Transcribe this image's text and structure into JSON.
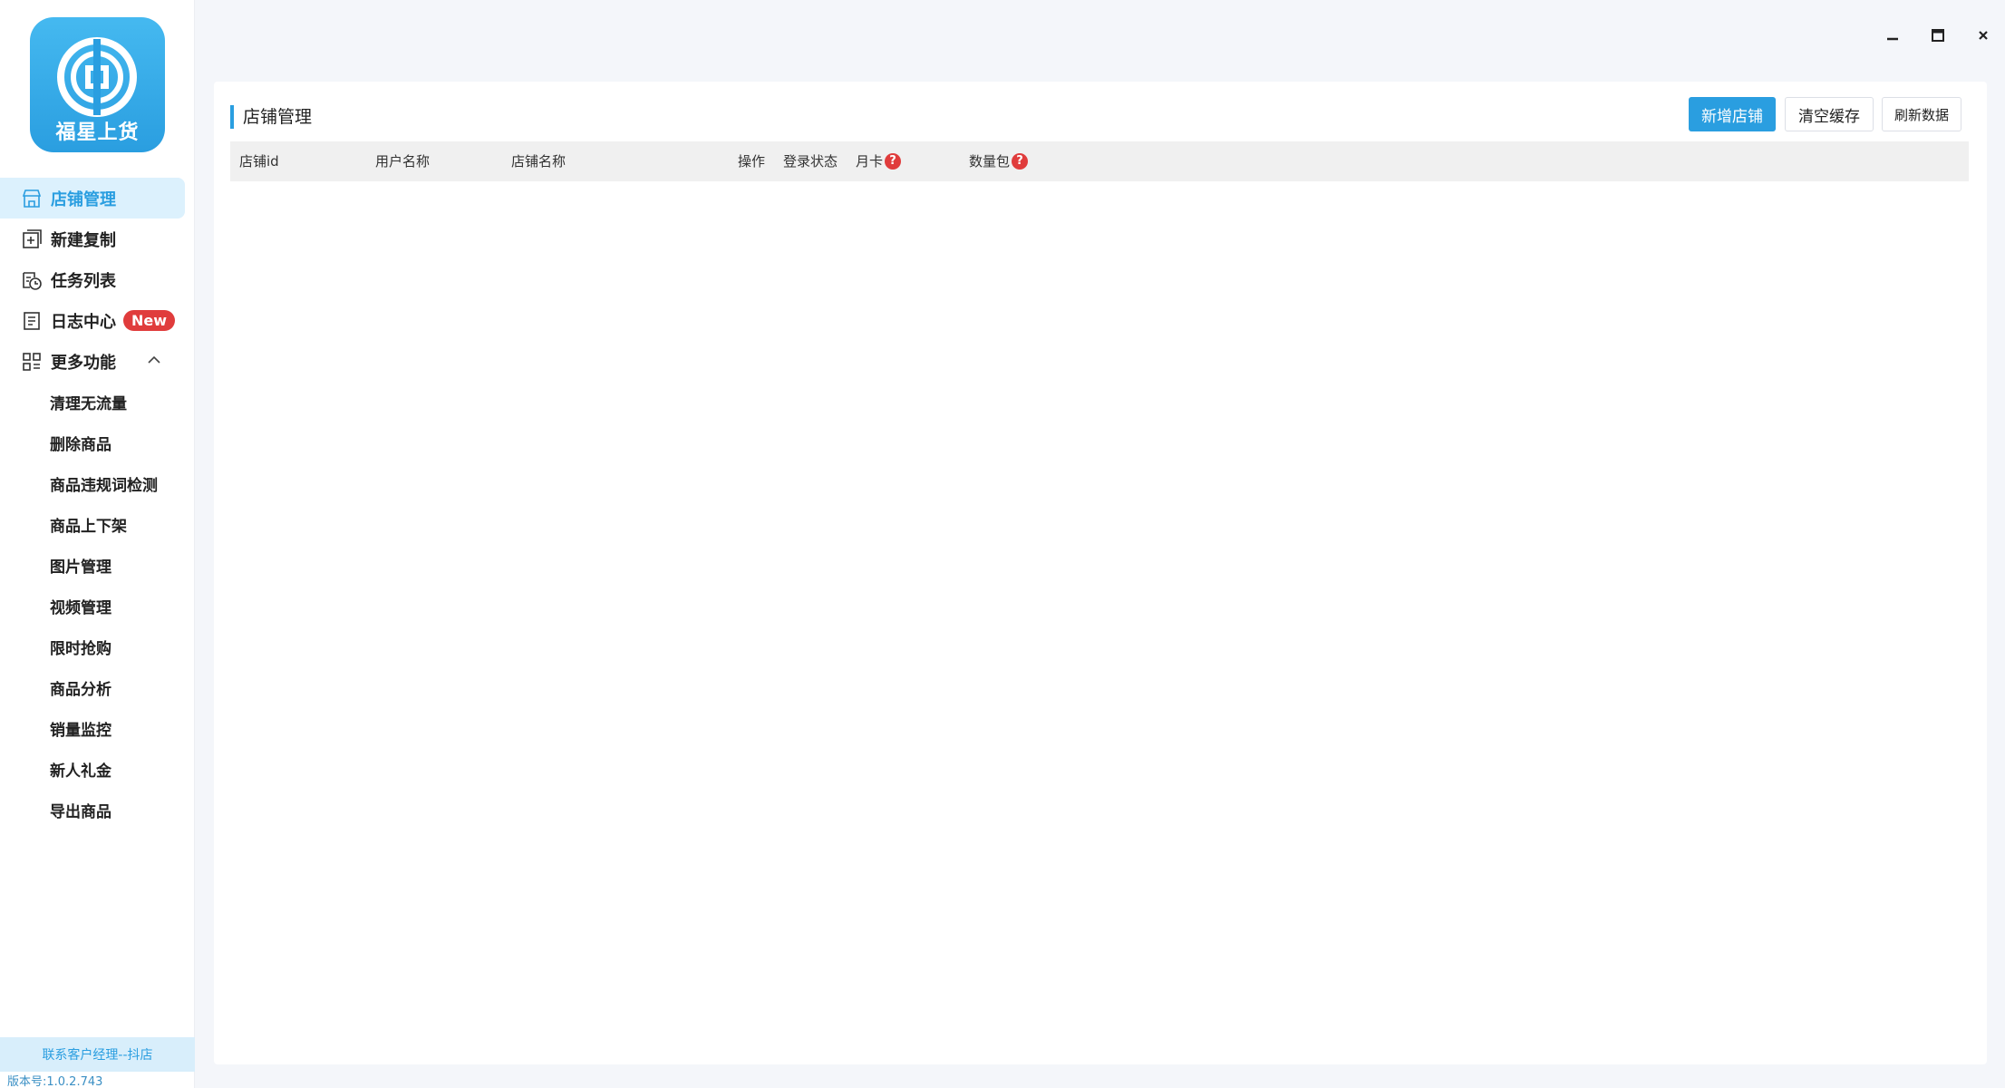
{
  "app": {
    "logo_text": "福星上货"
  },
  "sidebar": {
    "items": [
      {
        "label": "店铺管理",
        "icon": "store-icon",
        "active": true
      },
      {
        "label": "新建复制",
        "icon": "add-copy-icon"
      },
      {
        "label": "任务列表",
        "icon": "task-clock-icon"
      },
      {
        "label": "日志中心",
        "icon": "log-list-icon",
        "badge": "New"
      },
      {
        "label": "更多功能",
        "icon": "grid-icon"
      }
    ],
    "sub_items": [
      "清理无流量",
      "删除商品",
      "商品违规词检测",
      "商品上下架",
      "图片管理",
      "视频管理",
      "限时抢购",
      "商品分析",
      "销量监控",
      "新人礼金",
      "导出商品"
    ],
    "contact": "联系客户经理--抖店",
    "version": "版本号:1.0.2.743"
  },
  "main": {
    "title": "店铺管理",
    "buttons": {
      "add": "新增店铺",
      "clear": "清空缓存",
      "refresh": "刷新数据"
    },
    "columns": [
      "店铺id",
      "用户名称",
      "店铺名称",
      "操作",
      "登录状态",
      "月卡",
      "数量包"
    ],
    "help_mark": "?"
  },
  "colors": {
    "accent": "#2a9ee0",
    "badge": "#e03c3c",
    "active_bg": "#dcf1fd"
  }
}
